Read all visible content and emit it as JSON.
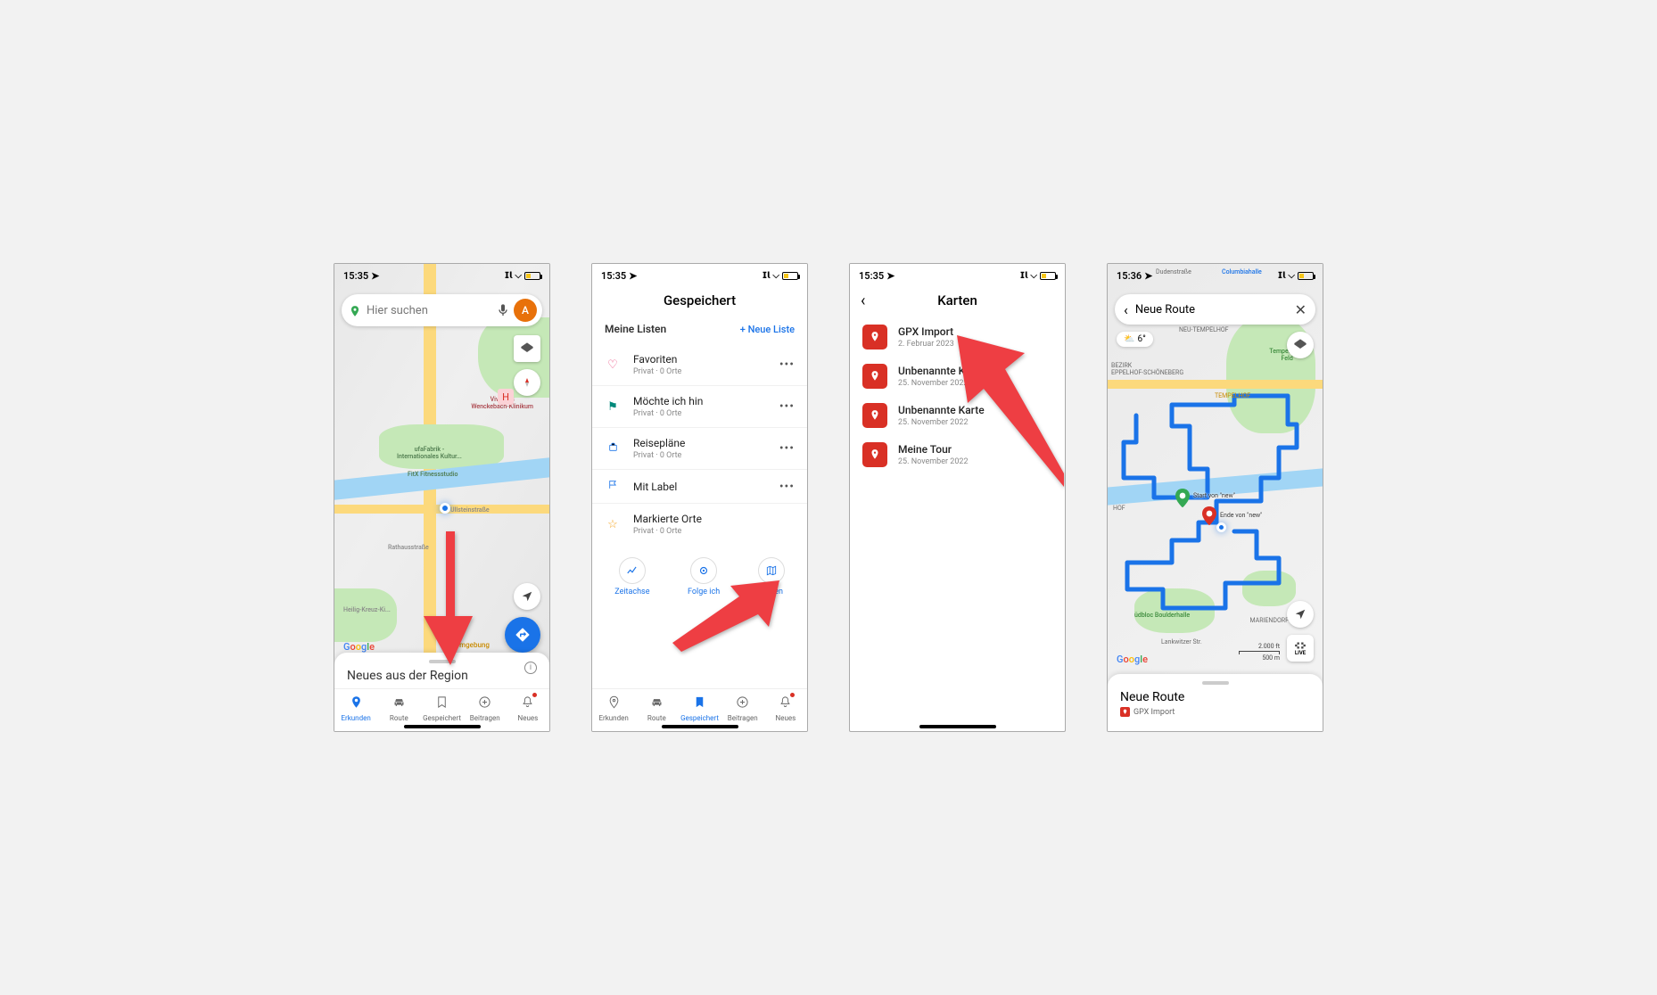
{
  "status": {
    "time1": "15:35",
    "time4": "15:36"
  },
  "phone1": {
    "search_placeholder": "Hier suchen",
    "avatar_letter": "A",
    "sheet_title": "Neues aus der Region",
    "map_labels": {
      "hospital": "Vivantes\nWenckebach-Klinikum",
      "ufafabrik": "ufaFabrik -\nInternationales Kultur...",
      "fitx": "FitX Fitnessstudio",
      "street1": "Ullsteinstraße",
      "street2": "Rathausstraße",
      "kreuz": "Heilig-Kreuz-Ki...",
      "umgebung": "te Umgebung"
    },
    "tabs": [
      {
        "label": "Erkunden",
        "icon": "pin",
        "active": true
      },
      {
        "label": "Route",
        "icon": "car",
        "active": false
      },
      {
        "label": "Gespeichert",
        "icon": "bookmark",
        "active": false
      },
      {
        "label": "Beitragen",
        "icon": "plus",
        "active": false
      },
      {
        "label": "Neues",
        "icon": "bell",
        "active": false
      }
    ]
  },
  "phone2": {
    "header": "Gespeichert",
    "section_title": "Meine Listen",
    "new_list": "Neue Liste",
    "lists": [
      {
        "title": "Favoriten",
        "sub": "Privat · 0 Orte",
        "icon": "heart",
        "color": "#ea4a7f"
      },
      {
        "title": "Möchte ich hin",
        "sub": "Privat · 0 Orte",
        "icon": "flag",
        "color": "#00897b"
      },
      {
        "title": "Reisepläne",
        "sub": "Privat · 0 Orte",
        "icon": "suitcase",
        "color": "#1a73e8"
      },
      {
        "title": "Mit Label",
        "sub": "",
        "icon": "label",
        "color": "#1a73e8"
      },
      {
        "title": "Markierte Orte",
        "sub": "Privat · 0 Orte",
        "icon": "star",
        "color": "#f5a623"
      }
    ],
    "actions": [
      {
        "label": "Zeitachse",
        "icon": "line"
      },
      {
        "label": "Folge ich",
        "icon": "follow"
      },
      {
        "label": "Karten",
        "icon": "map"
      }
    ],
    "tabs": [
      {
        "label": "Erkunden",
        "icon": "pin",
        "active": false
      },
      {
        "label": "Route",
        "icon": "car",
        "active": false
      },
      {
        "label": "Gespeichert",
        "icon": "bookmark",
        "active": true
      },
      {
        "label": "Beitragen",
        "icon": "plus",
        "active": false
      },
      {
        "label": "Neues",
        "icon": "bell",
        "active": false
      }
    ]
  },
  "phone3": {
    "header": "Karten",
    "maps": [
      {
        "title": "GPX Import",
        "sub": "2. Februar 2023"
      },
      {
        "title": "Unbenannte Karte",
        "sub": "25. November 2022"
      },
      {
        "title": "Unbenannte Karte",
        "sub": "25. November 2022"
      },
      {
        "title": "Meine Tour",
        "sub": "25. November 2022"
      }
    ]
  },
  "phone4": {
    "title": "Neue Route",
    "temp": "6°",
    "scale_top": "2.000 ft",
    "scale_bot": "500 m",
    "live": "LIVE",
    "sheet_title": "Neue Route",
    "sheet_sub": "GPX Import",
    "map_labels": {
      "dudenstr": "Dudenstraße",
      "columbiahalle": "Columbiahalle",
      "neu_tempelhof": "NEU-TEMPELHOF",
      "feld": "Tempelhofer\nFeld",
      "bezirk": "BEZIRK\nEPPELHOF-SCHÖNEBERG",
      "tempelhof": "TEMPELHOF",
      "hof": "HOF",
      "boulder": "üdbloc Boulderhalle",
      "mariendorf": "MARIENDORF",
      "lankwitz": "Lankwitzer Str.",
      "start": "Start von \"new\"",
      "ende": "Ende von \"new\""
    }
  }
}
